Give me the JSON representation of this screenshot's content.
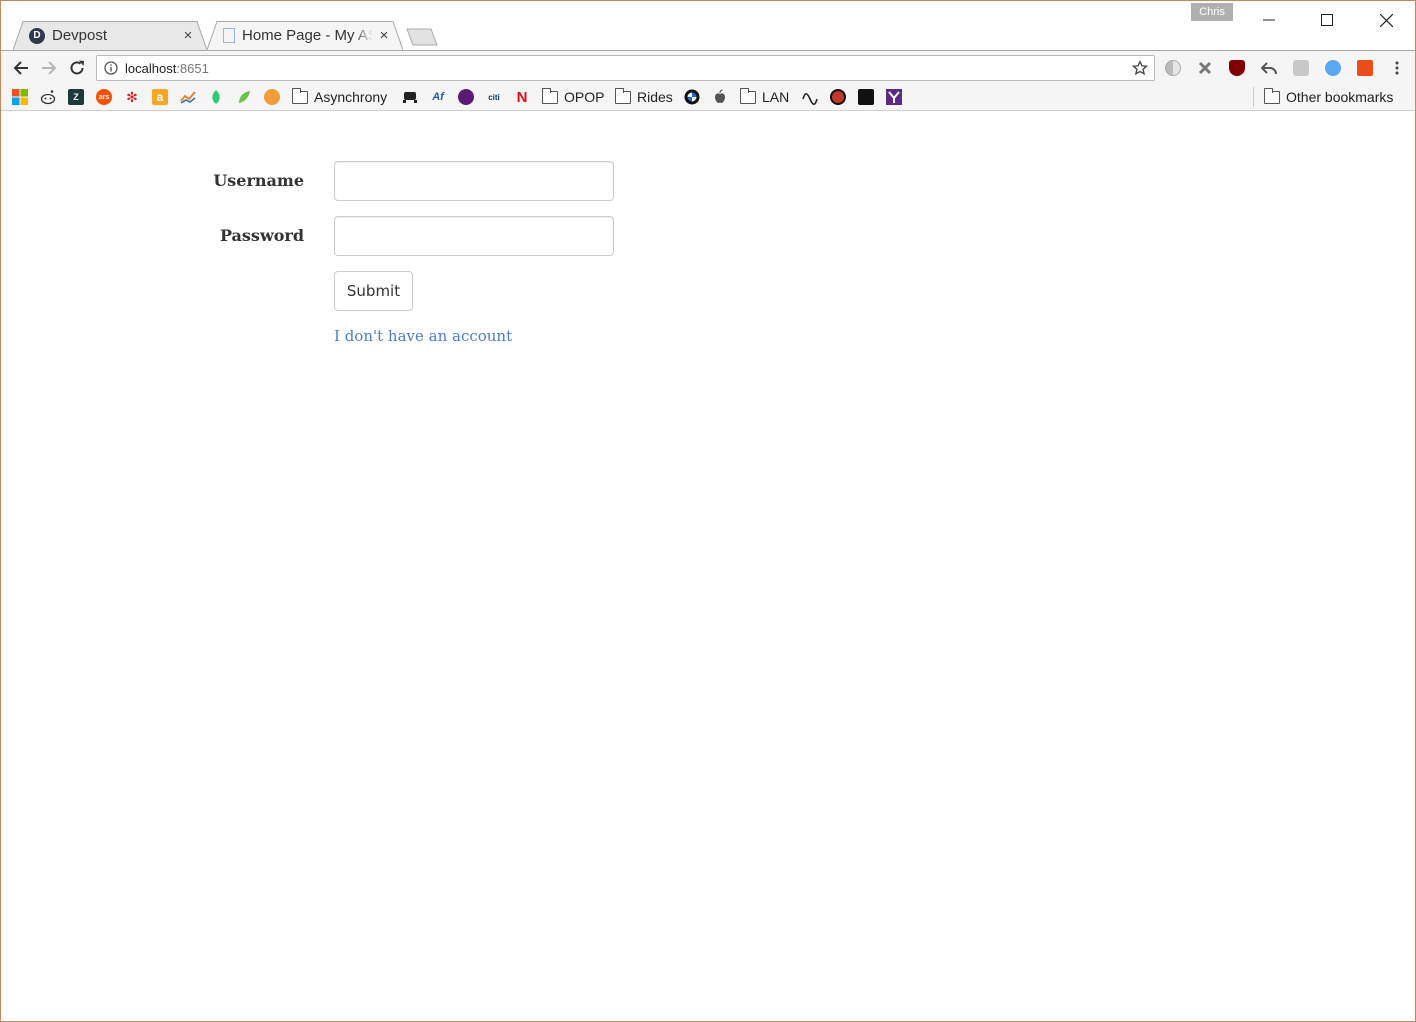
{
  "browser": {
    "tabs": [
      {
        "title": "Devpost",
        "favicon_letter": "D",
        "active": false
      },
      {
        "title": "Home Page - My AS",
        "active": true
      }
    ],
    "close_glyph": "×",
    "profile_name": "Chris",
    "address_bar": {
      "host": "localhost",
      "port": ":8651"
    },
    "bookmarks": {
      "folders": [
        "Asynchrony",
        "OPOP",
        "Rides",
        "LAN"
      ],
      "other_bookmarks": "Other bookmarks",
      "icon_labels": {
        "ars": "ars",
        "amazon": "a",
        "netflix": "N",
        "citi": "citi"
      }
    }
  },
  "form": {
    "username_label": "Username",
    "password_label": "Password",
    "username_value": "",
    "password_value": "",
    "submit_label": "Submit",
    "no_account_link": "I don't have an account"
  },
  "colors": {
    "link": "#4a7fcb",
    "window_border": "#c58a5c",
    "toolbar_bg": "#f5f5f5"
  }
}
